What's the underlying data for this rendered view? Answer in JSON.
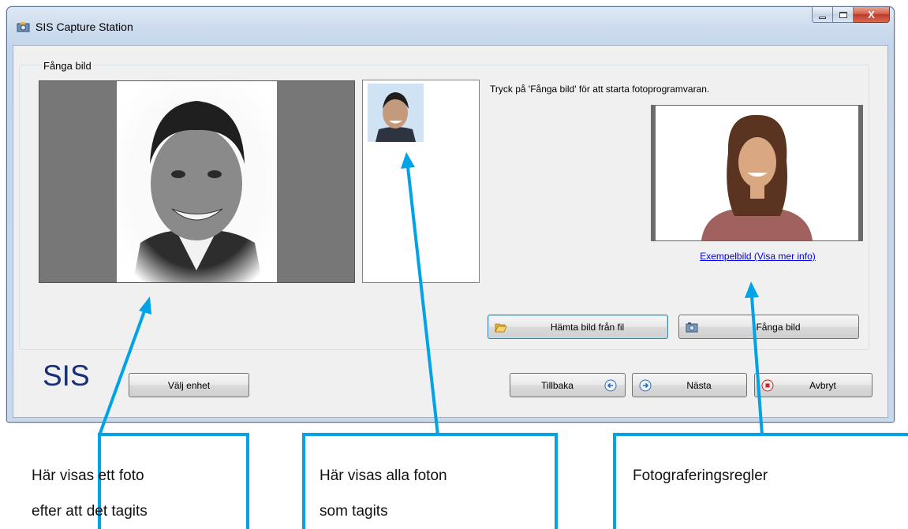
{
  "window": {
    "title": "SIS Capture Station",
    "close_glyph": "X"
  },
  "group": {
    "label": "Fånga bild"
  },
  "instruction": "Tryck på 'Fånga bild' för att starta fotoprogramvaran.",
  "example_link": "Exempelbild (Visa mer info)",
  "buttons": {
    "fetch_from_file": "Hämta bild från fil",
    "capture": "Fånga bild",
    "select_device": "Välj enhet",
    "back": "Tillbaka",
    "next": "Nästa",
    "cancel": "Avbryt"
  },
  "logo": "SIS",
  "callouts": {
    "left": [
      "Här visas ett foto",
      "efter att det tagits"
    ],
    "middle": [
      "Här visas alla foton",
      "som tagits"
    ],
    "right": [
      "Fotograferingsregler"
    ]
  },
  "colors": {
    "callout_accent": "#00a3e6",
    "logo": "#1a2f7a",
    "link": "#0000ee"
  },
  "icons": {
    "app": "camera-app-icon",
    "folder": "folder-open-icon",
    "camera": "camera-icon",
    "back": "arrow-left-circle-icon",
    "next": "arrow-right-circle-icon",
    "cancel": "stop-circle-icon"
  }
}
